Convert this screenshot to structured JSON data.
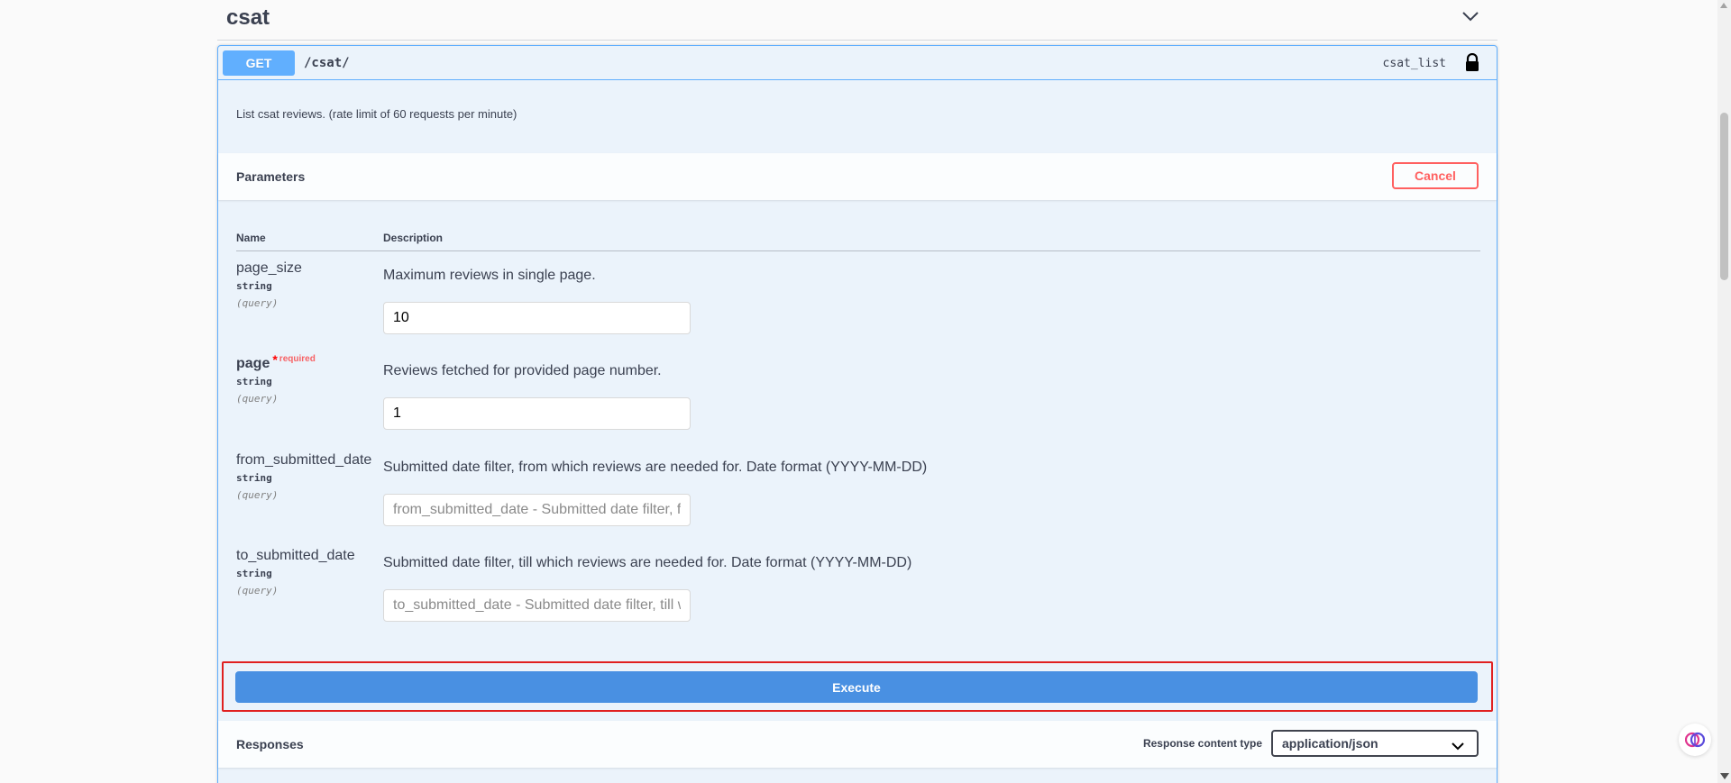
{
  "tag": {
    "title": "csat"
  },
  "operation": {
    "method": "GET",
    "path": "/csat/",
    "operation_id": "csat_list",
    "description": "List csat reviews. (rate limit of 60 requests per minute)"
  },
  "parameters_section": {
    "title": "Parameters",
    "cancel_label": "Cancel",
    "col_name": "Name",
    "col_description": "Description",
    "params": [
      {
        "name": "page_size",
        "type": "string",
        "in": "(query)",
        "description": "Maximum reviews in single page.",
        "value": "10",
        "placeholder": ""
      },
      {
        "name": "page",
        "required_star": "*",
        "required_label": "required",
        "type": "string",
        "in": "(query)",
        "description": "Reviews fetched for provided page number.",
        "value": "1",
        "placeholder": ""
      },
      {
        "name": "from_submitted_date",
        "type": "string",
        "in": "(query)",
        "description": "Submitted date filter, from which reviews are needed for. Date format (YYYY-MM-DD)",
        "value": "",
        "placeholder": "from_submitted_date - Submitted date filter, from which reviews are needed for. Date format (YYYY-MM-DD)"
      },
      {
        "name": "to_submitted_date",
        "type": "string",
        "in": "(query)",
        "description": "Submitted date filter, till which reviews are needed for. Date format (YYYY-MM-DD)",
        "value": "",
        "placeholder": "to_submitted_date - Submitted date filter, till which reviews are needed for. Date format (YYYY-MM-DD)"
      }
    ]
  },
  "execute": {
    "label": "Execute"
  },
  "responses": {
    "title": "Responses",
    "content_type_label": "Response content type",
    "content_type_value": "application/json"
  },
  "colors": {
    "get_method": "#61affe",
    "execute": "#4990e2",
    "cancel": "#ff6060",
    "highlight": "#e02020"
  }
}
